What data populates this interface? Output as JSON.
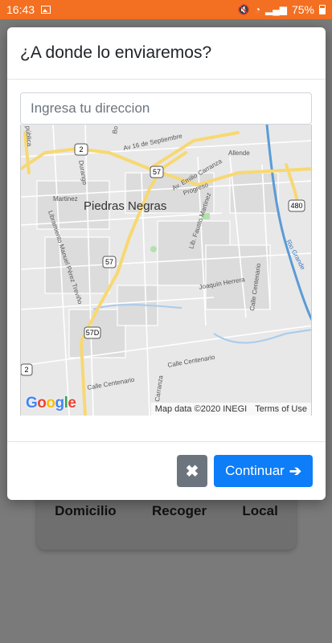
{
  "status_bar": {
    "time": "16:43",
    "battery": "75%"
  },
  "background": {
    "options": [
      "Domicilio",
      "Recoger",
      "Local"
    ]
  },
  "modal": {
    "title": "¿A donde lo enviaremos?",
    "search": {
      "placeholder": "Ingresa tu direccion",
      "value": ""
    },
    "map": {
      "city_label": "Piedras Negras",
      "street_labels": {
        "av16": "Av 16 de Septiembre",
        "allende": "Allende",
        "carranza": "Av. Emilio Carranza",
        "progreso": "Progreso",
        "martinez": "Martinez",
        "libramiento": "Libramiento Manuel Pérez Treviño",
        "fausto": "Lib. Fausto Martínez",
        "joaquin": "Joaquín Herrera",
        "centenario1": "Calle Centenario",
        "centenario2": "Calle Centenario",
        "centenario3": "Calle Centenario",
        "carranza2": "Carranza",
        "rio": "Rio Grande",
        "durango": "Durango",
        "publica": "pública",
        "bo": "Bo"
      },
      "shields": {
        "r2a": "2",
        "r2b": "2",
        "r57a": "57",
        "r57b": "57",
        "r57d": "57D",
        "r480": "480"
      },
      "google": "Google",
      "attribution": "Map data ©2020 INEGI",
      "terms": "Terms of Use"
    },
    "close_button": "✖",
    "continue_button": "Continuar"
  }
}
